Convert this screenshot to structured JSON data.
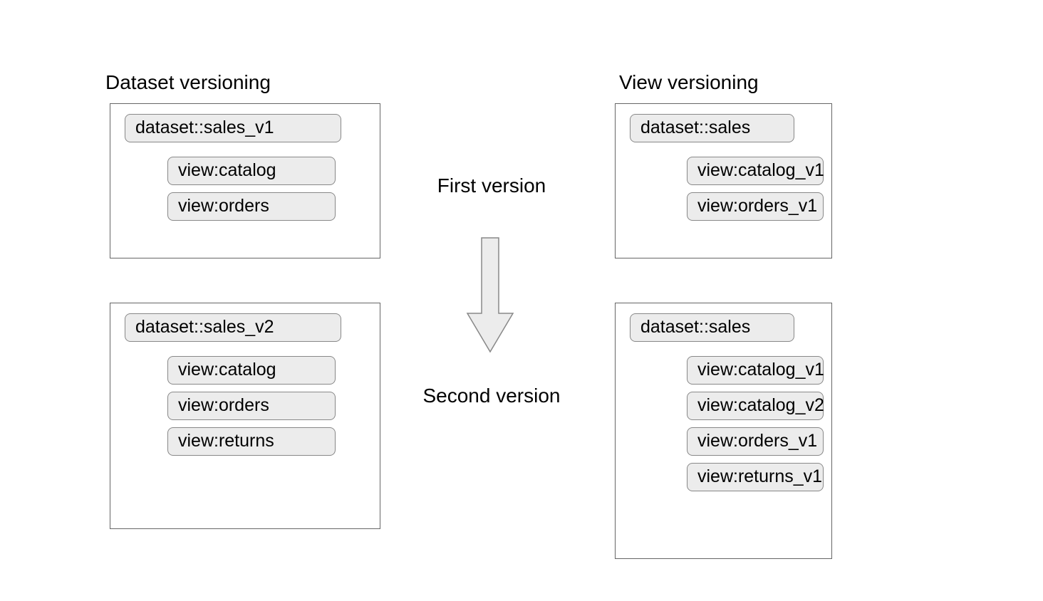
{
  "headings": {
    "left": "Dataset versioning",
    "right": "View versioning"
  },
  "center": {
    "first": "First version",
    "second": "Second version"
  },
  "left_v1": {
    "dataset": "dataset::sales_v1",
    "views": [
      "view:catalog",
      "view:orders"
    ]
  },
  "left_v2": {
    "dataset": "dataset::sales_v2",
    "views": [
      "view:catalog",
      "view:orders",
      "view:returns"
    ]
  },
  "right_v1": {
    "dataset": "dataset::sales",
    "views": [
      "view:catalog_v1",
      "view:orders_v1"
    ]
  },
  "right_v2": {
    "dataset": "dataset::sales",
    "views": [
      "view:catalog_v1",
      "view:catalog_v2",
      "view:orders_v1",
      "view:returns_v1"
    ]
  }
}
